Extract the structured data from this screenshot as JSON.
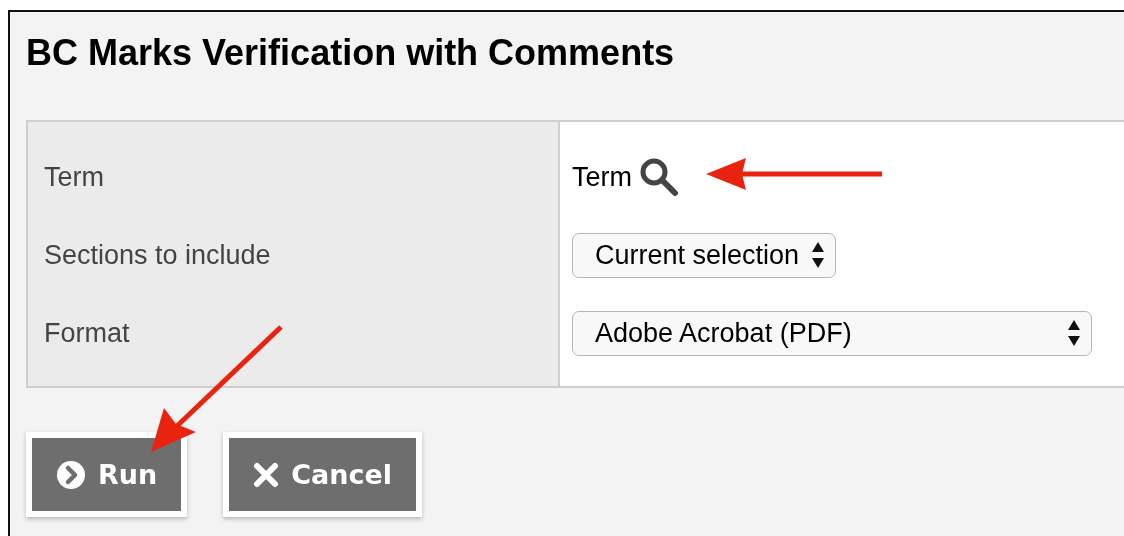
{
  "title": "BC Marks Verification with Comments",
  "fields": [
    {
      "label": "Term",
      "kind": "lookup",
      "value": "Term"
    },
    {
      "label": "Sections to include",
      "kind": "select",
      "value": "Current selection"
    },
    {
      "label": "Format",
      "kind": "select",
      "value": "Adobe Acrobat (PDF)"
    }
  ],
  "buttons": [
    {
      "label": "Run",
      "kind": "run"
    },
    {
      "label": "Cancel",
      "kind": "cancel"
    }
  ]
}
